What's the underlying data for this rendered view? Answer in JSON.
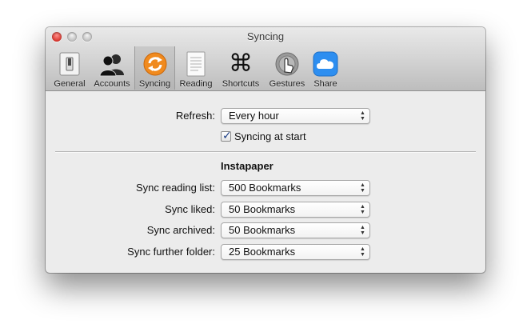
{
  "window": {
    "title": "Syncing"
  },
  "toolbar": {
    "tabs": [
      {
        "label": "General",
        "icon": "switch-icon"
      },
      {
        "label": "Accounts",
        "icon": "users-icon"
      },
      {
        "label": "Syncing",
        "icon": "sync-icon",
        "selected": true
      },
      {
        "label": "Reading",
        "icon": "document-icon"
      },
      {
        "label": "Shortcuts",
        "icon": "command-key-icon"
      },
      {
        "label": "Gestures",
        "icon": "gesture-icon"
      },
      {
        "label": "Share",
        "icon": "cloud-icon"
      }
    ]
  },
  "refresh": {
    "label": "Refresh:",
    "value": "Every hour"
  },
  "sync_at_start": {
    "label": "Syncing at start",
    "checked": true
  },
  "instapaper": {
    "title": "Instapaper",
    "sync_reading_list": {
      "label": "Sync reading list:",
      "value": "500 Bookmarks"
    },
    "sync_liked": {
      "label": "Sync liked:",
      "value": "50 Bookmarks"
    },
    "sync_archived": {
      "label": "Sync archived:",
      "value": "50 Bookmarks"
    },
    "sync_further_folder": {
      "label": "Sync further folder:",
      "value": "25 Bookmarks"
    }
  },
  "colors": {
    "close_button": "#d8352d",
    "sync_icon": "#f08a1e",
    "checkmark": "#1c3e86"
  }
}
